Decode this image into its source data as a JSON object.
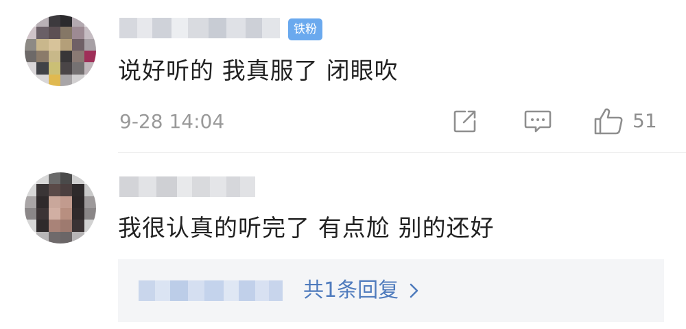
{
  "comments": [
    {
      "username": "",
      "badge": "铁粉",
      "text": "说好听的 我真服了 闭眼吹",
      "timestamp": "9-28 14:04",
      "like_count": "51",
      "actions": {
        "share_icon": "share-icon",
        "reply_icon": "comment-icon",
        "like_icon": "thumbs-up-icon"
      }
    },
    {
      "username": "",
      "text": "我很认真的听完了 有点尬 别的还好",
      "replies": {
        "preview": "",
        "link_label": "共1条回复",
        "chevron_icon": "chevron-right-icon"
      }
    }
  ],
  "colors": {
    "badge_bg": "#6aa9ee",
    "link": "#4f7bbd",
    "meta_gray": "#999999",
    "reply_box_bg": "#f4f5f7"
  }
}
